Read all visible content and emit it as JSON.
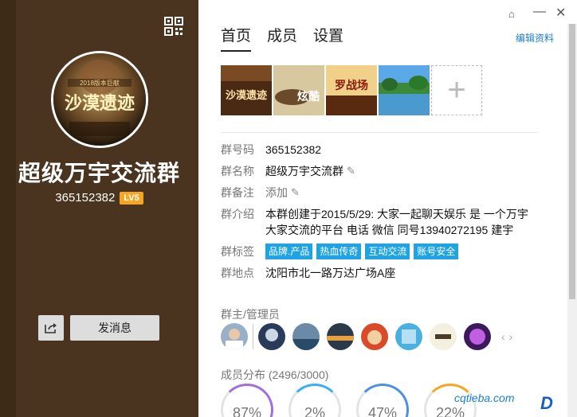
{
  "group": {
    "name": "超级万宇交流群",
    "id": "365152382",
    "level": "LV5"
  },
  "actions": {
    "send_message": "发消息"
  },
  "tabs": [
    {
      "label": "首页",
      "active": true
    },
    {
      "label": "成员",
      "active": false
    },
    {
      "label": "设置",
      "active": false
    }
  ],
  "edit_profile": "编辑资料",
  "info": {
    "number": {
      "label": "群号码",
      "value": "365152382"
    },
    "name": {
      "label": "群名称",
      "value": "超级万宇交流群"
    },
    "remark": {
      "label": "群备注",
      "value": "添加"
    },
    "intro": {
      "label": "群介绍",
      "value": "本群创建于2015/5/29: 大家一起聊天娱乐 是 一个万宇 大家交流的平台 电话 微信 同号13940272195 建宇"
    },
    "tags": {
      "label": "群标签",
      "values": [
        "品牌.产品",
        "热血传奇",
        "互动交流",
        "账号安全"
      ]
    },
    "location": {
      "label": "群地点",
      "value": "沈阳市北一路万达广场A座"
    }
  },
  "admins_title": "群主/管理员",
  "distribution": {
    "title": "成员分布",
    "count": "(2496/3000)",
    "percents": [
      "87%",
      "2%",
      "47%",
      "22%"
    ]
  },
  "avatar_text": {
    "title": "沙漠遗迹",
    "subtitle": "2018版本巨献"
  },
  "photo_texts": [
    "沙漠遗迹",
    "炫酷",
    "罗战场"
  ],
  "watermark": "cqtieba.com",
  "colors": {
    "left_bg": "#4a341f",
    "tag_bg": "#1fa3e3",
    "link": "#1a7fd4",
    "level_badge": "#f5a623"
  }
}
